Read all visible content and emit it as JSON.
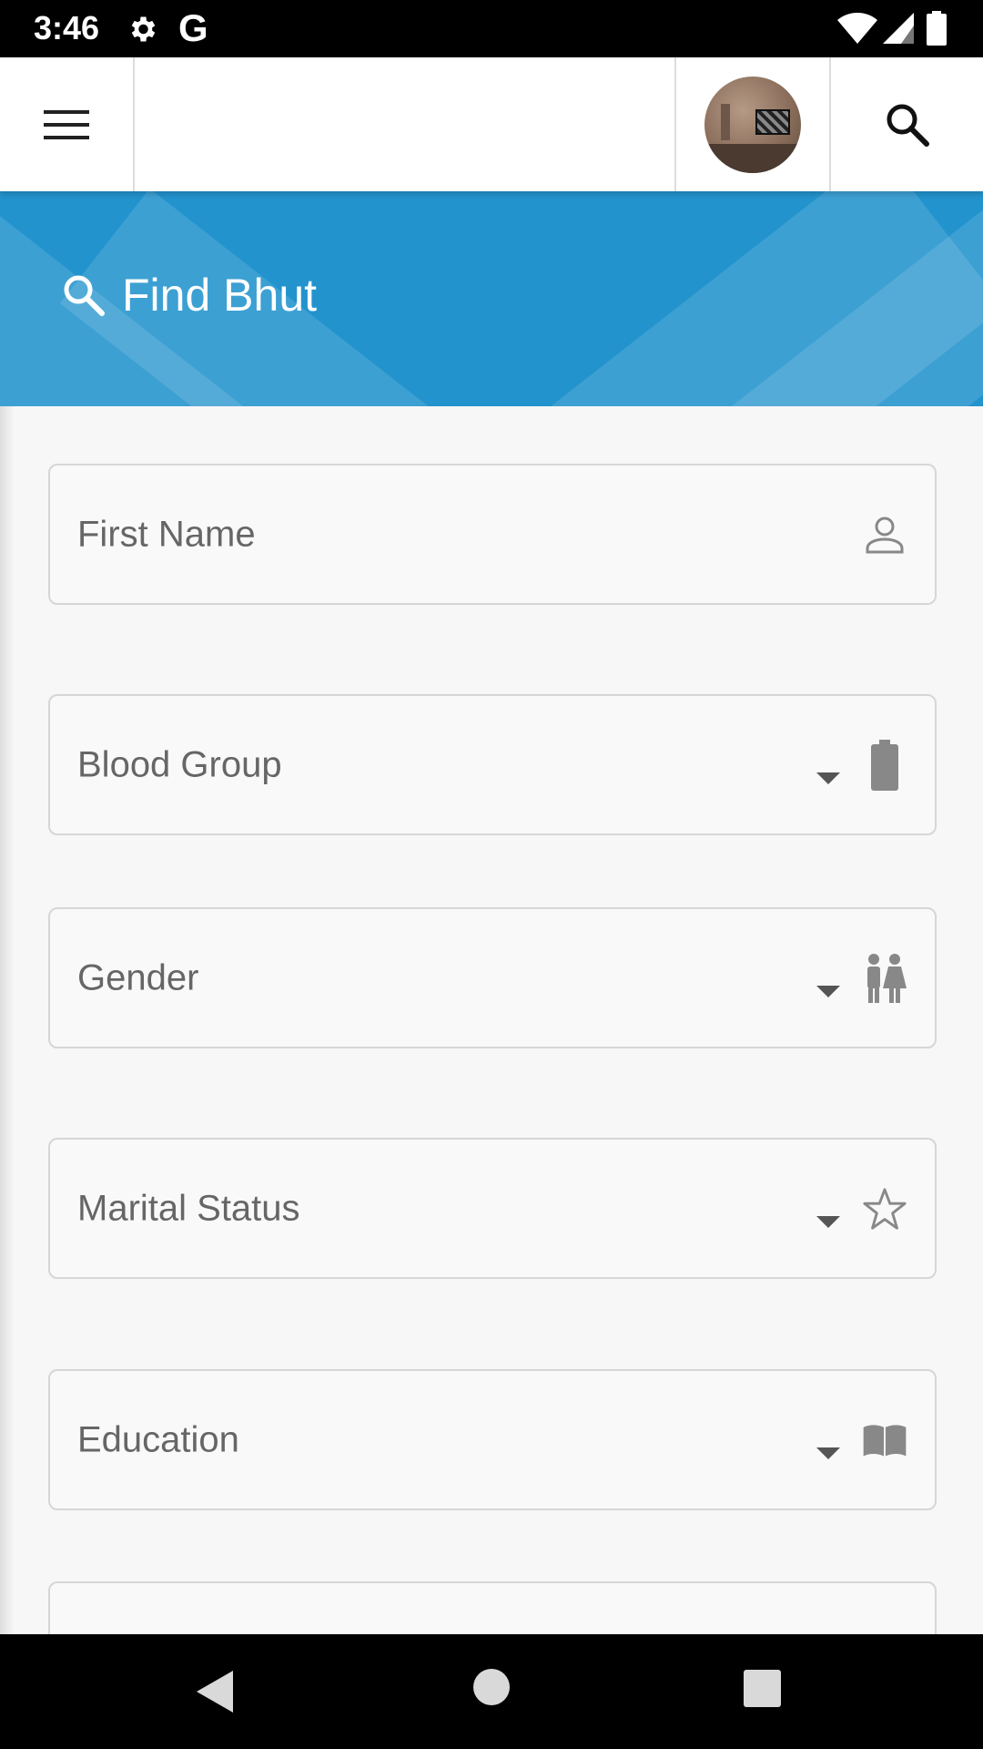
{
  "status_bar": {
    "time": "3:46",
    "g_label": "G"
  },
  "header": {
    "title": "Find Bhut"
  },
  "form": {
    "fields": [
      {
        "label": "First Name",
        "icon": "person-icon",
        "dropdown": false
      },
      {
        "label": "Blood Group",
        "icon": "battery-icon",
        "dropdown": true
      },
      {
        "label": "Gender",
        "icon": "people-icon",
        "dropdown": true
      },
      {
        "label": "Marital Status",
        "icon": "star-icon",
        "dropdown": true
      },
      {
        "label": "Education",
        "icon": "book-icon",
        "dropdown": true
      }
    ]
  },
  "colors": {
    "banner": "#2393cd",
    "field_border": "#d6d6d6",
    "label": "#666666"
  }
}
